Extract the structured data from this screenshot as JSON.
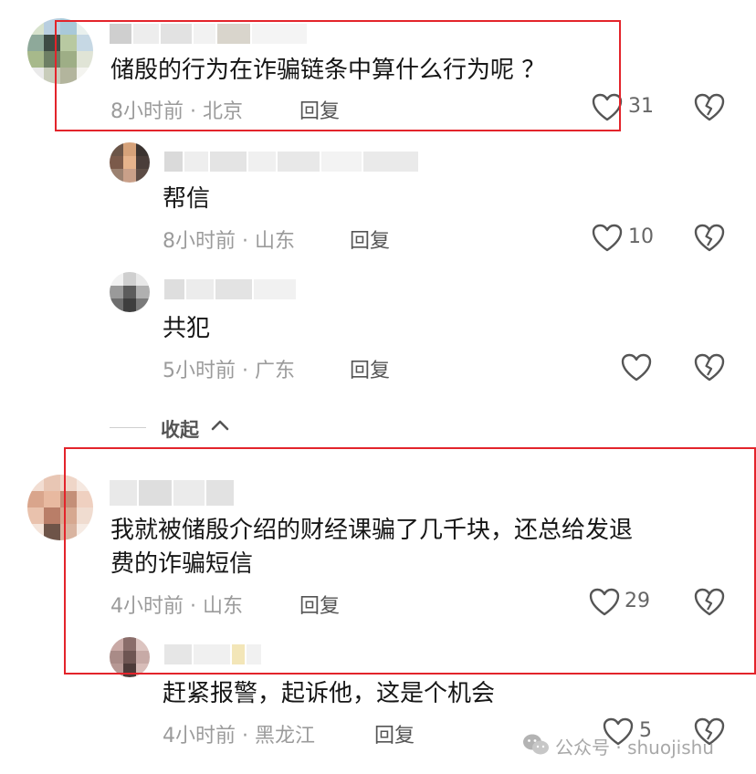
{
  "comments": [
    {
      "text_lines": [
        "储殷的行为在诈骗链条中算什么行为呢 ？"
      ],
      "meta": "8小时前 · 北京",
      "reply_label": "回复",
      "likes": "31",
      "replies": [
        {
          "text": "帮信",
          "meta": "8小时前 · 山东",
          "reply_label": "回复",
          "likes": "10"
        },
        {
          "text": "共犯",
          "meta": "5小时前 · 广东",
          "reply_label": "回复",
          "likes": ""
        }
      ],
      "collapse_label": "收起"
    },
    {
      "text_lines": [
        "我就被储殷介绍的财经课骗了几千块，还总给发退",
        "费的诈骗短信"
      ],
      "meta": "4小时前 · 山东",
      "reply_label": "回复",
      "likes": "29",
      "replies": [
        {
          "text": "赶紧报警，起诉他，这是个机会",
          "meta": "4小时前 · 黑龙江",
          "reply_label": "回复",
          "likes": "5"
        }
      ]
    }
  ],
  "watermark": {
    "text": "公众号 · shuojishu"
  },
  "colors": {
    "highlight_box": "#e3242b",
    "meta_gray": "#9b9b9b",
    "text": "#161616"
  },
  "icons": [
    "heart-outline-icon",
    "broken-heart-icon",
    "chevron-up-icon",
    "wechat-icon"
  ]
}
